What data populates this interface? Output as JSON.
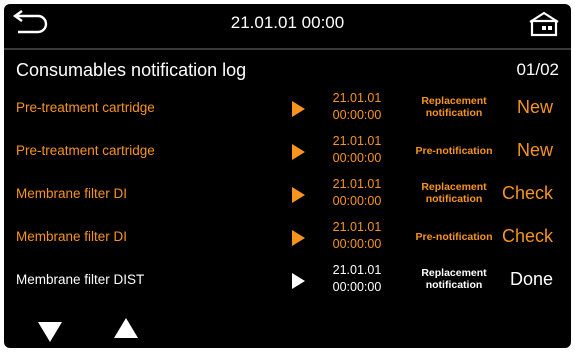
{
  "header": {
    "clock": "21.01.01 00:00",
    "back_icon": "return-arrow-icon",
    "home_icon": "home-icon"
  },
  "page": {
    "title": "Consumables notification log",
    "pager": "01/02"
  },
  "colors": {
    "background": "#000000",
    "accent": "#f7941d",
    "text": "#ffffff"
  },
  "rows": [
    {
      "name": "Pre-treatment cartridge",
      "date": "21.01.01",
      "time": "00:00:00",
      "type_line1": "Replacement",
      "type_line2": "notification",
      "status": "New",
      "color": "orange"
    },
    {
      "name": "Pre-treatment cartridge",
      "date": "21.01.01",
      "time": "00:00:00",
      "type_line1": "Pre-notification",
      "type_line2": "",
      "status": "New",
      "color": "orange"
    },
    {
      "name": "Membrane filter DI",
      "date": "21.01.01",
      "time": "00:00:00",
      "type_line1": "Replacement",
      "type_line2": "notification",
      "status": "Check",
      "color": "orange"
    },
    {
      "name": "Membrane filter DI",
      "date": "21.01.01",
      "time": "00:00:00",
      "type_line1": "Pre-notification",
      "type_line2": "",
      "status": "Check",
      "color": "orange"
    },
    {
      "name": "Membrane filter DIST",
      "date": "21.01.01",
      "time": "00:00:00",
      "type_line1": "Replacement",
      "type_line2": "notification",
      "status": "Done",
      "color": "white"
    }
  ],
  "footer": {
    "down_icon": "triangle-down-icon",
    "up_icon": "triangle-up-icon"
  }
}
